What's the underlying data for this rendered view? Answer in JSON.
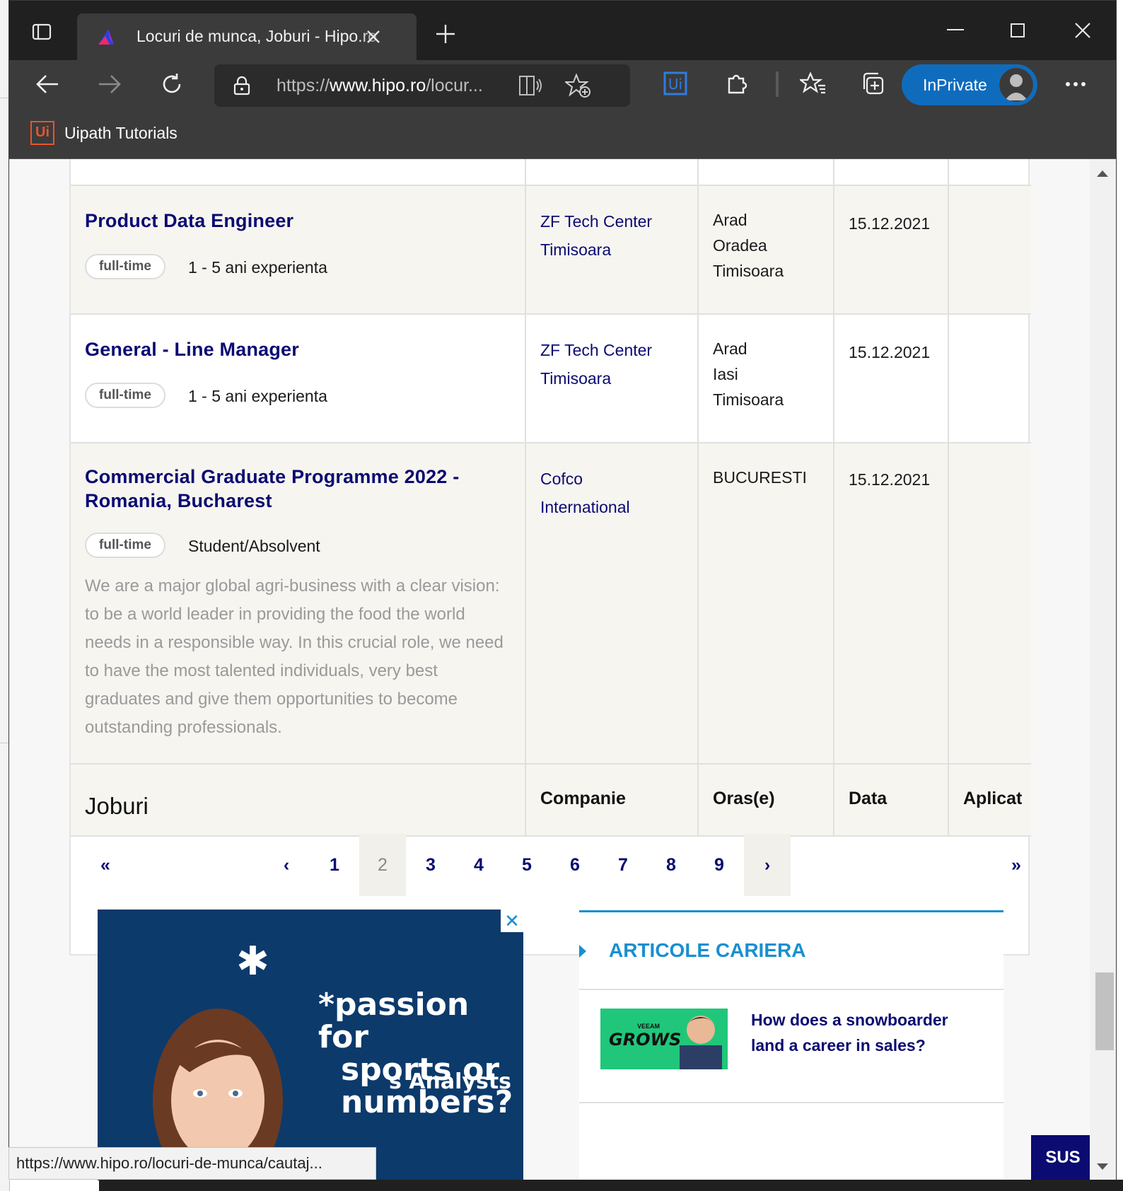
{
  "browser": {
    "tab_title": "Locuri de munca, Joburi - Hipo.ro",
    "url_prefix": "https://",
    "url_domain": "www.hipo.ro",
    "url_rest": "/locur...",
    "inprivate_label": "InPrivate",
    "favorite_label": "Uipath Tutorials",
    "ui_logo_text": "Ui",
    "status_url": "https://www.hipo.ro/locuri-de-munca/cautaj..."
  },
  "jobs": [
    {
      "title": "Product Data Engineer",
      "type": "full-time",
      "experience": "1 - 5 ani experienta",
      "company_line1": "ZF Tech Center",
      "company_line2": "Timisoara",
      "cities": [
        "Arad",
        "Oradea",
        "Timisoara"
      ],
      "date": "15.12.2021"
    },
    {
      "title": "General - Line Manager",
      "type": "full-time",
      "experience": "1 - 5 ani experienta",
      "company_line1": "ZF Tech Center",
      "company_line2": "Timisoara",
      "cities": [
        "Arad",
        "Iasi",
        "Timisoara"
      ],
      "date": "15.12.2021"
    },
    {
      "title_line1": "Commercial Graduate Programme 2022 -",
      "title_line2": "Romania, Bucharest",
      "type": "full-time",
      "experience": "Student/Absolvent",
      "company_line1": "Cofco",
      "company_line2": "International",
      "cities": [
        "BUCURESTI"
      ],
      "date": "15.12.2021",
      "description": "We are a major global agri-business with a clear vision: to be a world leader in providing the food the world needs in a responsible way. In this crucial role, we need to have the most talented individuals, very best graduates and give them opportunities to become outstanding professionals."
    }
  ],
  "table_header": {
    "jobs": "Joburi",
    "company": "Companie",
    "cities": "Oras(e)",
    "date": "Data",
    "apply": "Aplicat"
  },
  "pagination": {
    "first": "«",
    "prev": "‹",
    "pages": [
      "1",
      "2",
      "3",
      "4",
      "5",
      "6",
      "7",
      "8",
      "9"
    ],
    "current": "2",
    "next": "›",
    "last": "»"
  },
  "ad": {
    "close": "✕",
    "asterisk": "✱",
    "line1": "*passion for",
    "line2": "sports or",
    "line3": "numbers?",
    "line4": "s Analysts"
  },
  "articles": {
    "heading": "ARTICOLE CARIERA",
    "item_title": "How does a snowboarder land a career in sales?",
    "thumb_brand": "VEEAM",
    "thumb_text": "GROWS"
  },
  "scroll_top_button": "SUS",
  "colors": {
    "brand_navy": "#0b0b72",
    "accent_blue": "#1a8fd0",
    "inprivate": "#0f6cbd",
    "row_alt": "#f6f5f0"
  }
}
